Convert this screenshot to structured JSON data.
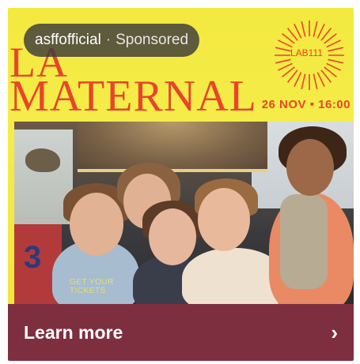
{
  "ad": {
    "advertiser_handle": "asffofficial",
    "separator": "·",
    "sponsored_label": "Sponsored"
  },
  "poster": {
    "title_line1": "LA",
    "title_line2": "MATERNAL",
    "date_text": "26 NOV • 16:00",
    "logo_text": "LAB111",
    "overlay_text_line1": "GET YOUR",
    "overlay_text_line2": "TICKETS",
    "panel_number": "3",
    "colors": {
      "background": "#f3e93f",
      "title": "#e8452a"
    }
  },
  "cta": {
    "label": "Learn more",
    "icon": "chevron-right-icon",
    "background": "#7e2f3f"
  }
}
